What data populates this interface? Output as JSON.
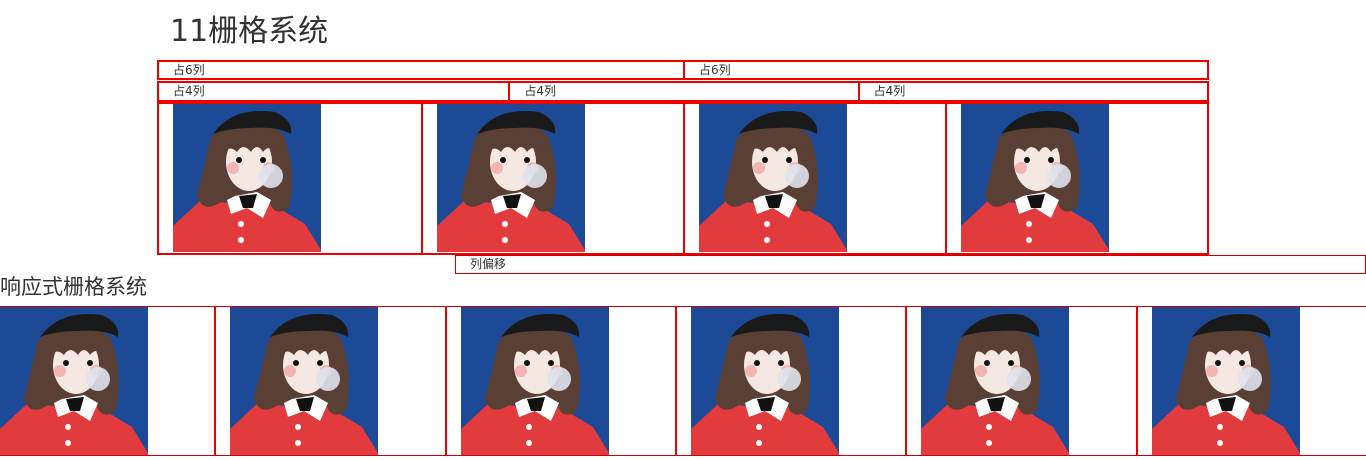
{
  "title": "11栅格系统",
  "row_six": [
    "占6列",
    "占6列"
  ],
  "row_four": [
    "占4列",
    "占4列",
    "占4列"
  ],
  "offset_label": "列偏移",
  "responsive_title": "响应式栅格系统",
  "image_subject": "cartoon-girl-portrait",
  "colors": {
    "border": "#ee0000",
    "image_bg": "#1c4a96",
    "coat": "#e23b3d",
    "hair": "#5a3f35"
  }
}
